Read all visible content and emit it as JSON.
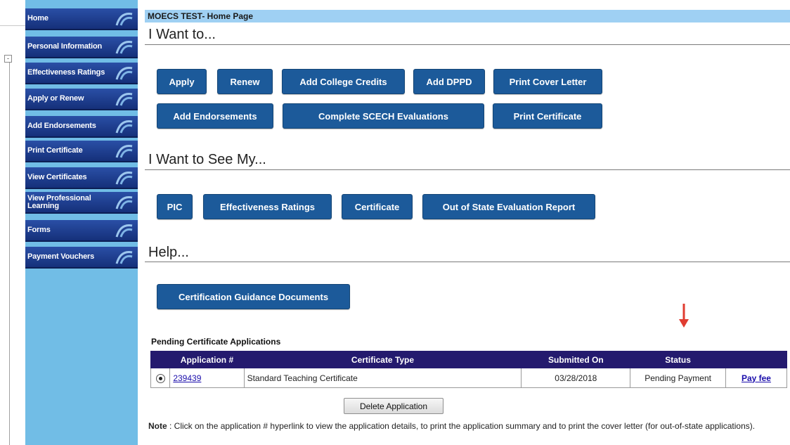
{
  "sidebar": {
    "items": [
      {
        "label": "Home"
      },
      {
        "label": "Personal Information"
      },
      {
        "label": "Effectiveness Ratings"
      },
      {
        "label": "Apply or Renew"
      },
      {
        "label": "Add Endorsements"
      },
      {
        "label": "Print Certificate"
      },
      {
        "label": "View Certificates"
      },
      {
        "label": "View Professional Learning"
      },
      {
        "label": "Forms"
      },
      {
        "label": "Payment Vouchers"
      }
    ]
  },
  "header": {
    "title": "MOECS TEST- Home Page"
  },
  "want_to": {
    "title": "I Want to...",
    "buttons": [
      "Apply",
      "Renew",
      "Add College Credits",
      "Add DPPD",
      "Print Cover Letter",
      "Add Endorsements",
      "Complete SCECH Evaluations",
      "Print Certificate"
    ]
  },
  "want_to_see": {
    "title": "I Want to See My...",
    "buttons": [
      "PIC",
      "Effectiveness Ratings",
      "Certificate",
      "Out of State Evaluation Report"
    ]
  },
  "help": {
    "title": "Help...",
    "buttons": [
      "Certification Guidance Documents"
    ]
  },
  "pending": {
    "title": "Pending Certificate Applications",
    "columns": [
      "Application #",
      "Certificate Type",
      "Submitted On",
      "Status",
      ""
    ],
    "rows": [
      {
        "selected": true,
        "application": "239439",
        "certificate_type": "Standard Teaching Certificate",
        "submitted_on": "03/28/2018",
        "status": "Pending Payment",
        "action": "Pay fee"
      }
    ],
    "delete_label": "Delete Application",
    "note_label": "Note",
    "note_text": " : Click on the application # hyperlink to view the application details, to print the application summary and to print the cover letter (for out-of-state applications)."
  },
  "colors": {
    "sidebar_bg": "#71bde6",
    "nav_item": "#1f4494",
    "button": "#1c5a9a",
    "table_header": "#241a6e",
    "arrow": "#e03c31"
  }
}
